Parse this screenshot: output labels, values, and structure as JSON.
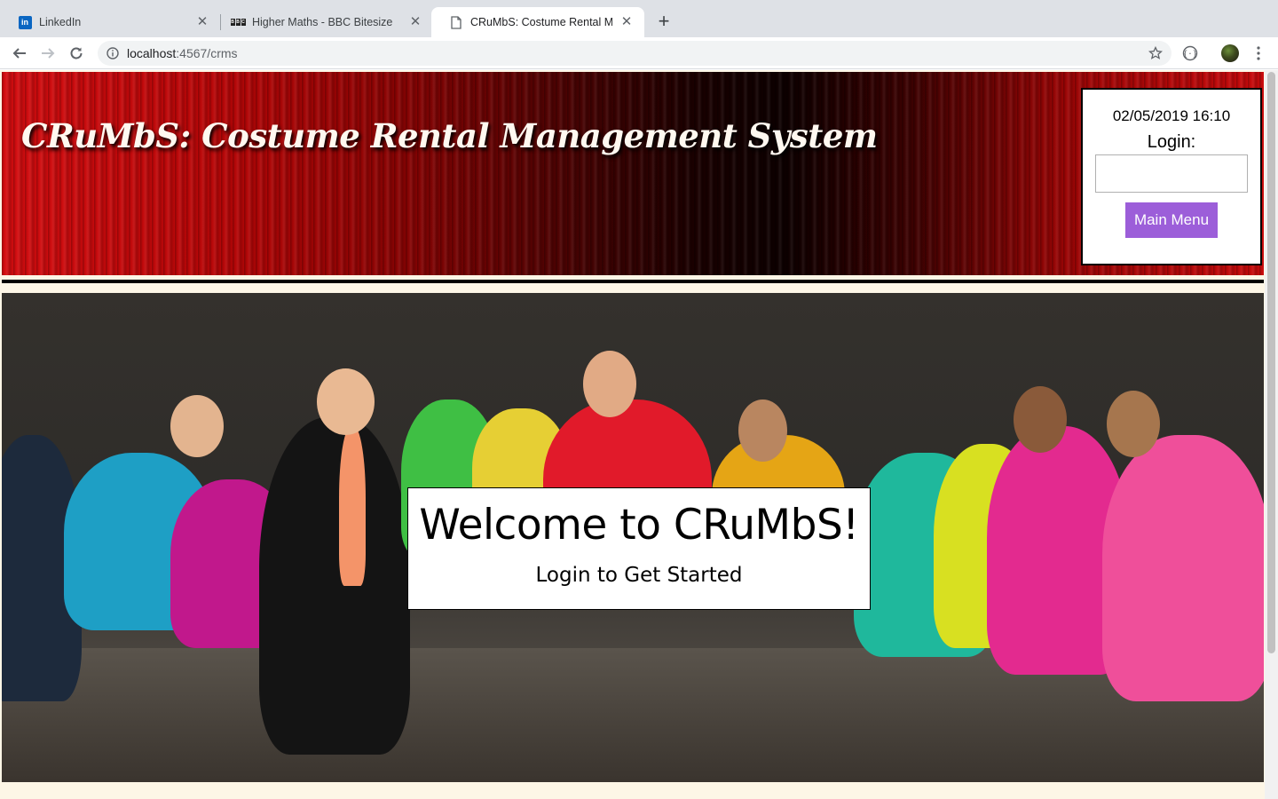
{
  "browser": {
    "tabs": [
      {
        "title": "LinkedIn",
        "icon": "linkedin-icon",
        "active": false
      },
      {
        "title": "Higher Maths - BBC Bitesize",
        "icon": "bbc-icon",
        "active": false
      },
      {
        "title": "CRuMbS: Costume Rental Man",
        "icon": "page-icon",
        "active": true
      }
    ],
    "url_host": "localhost",
    "url_path": ":4567/crms"
  },
  "header": {
    "site_title": "CRuMbS: Costume Rental Management System",
    "datetime": "02/05/2019 16:10",
    "login_label": "Login:",
    "login_value": "",
    "main_menu_label": "Main Menu",
    "button_color": "#9c5ed9"
  },
  "hero": {
    "welcome_title": "Welcome to CRuMbS!",
    "welcome_subtitle": "Login to Get Started"
  }
}
